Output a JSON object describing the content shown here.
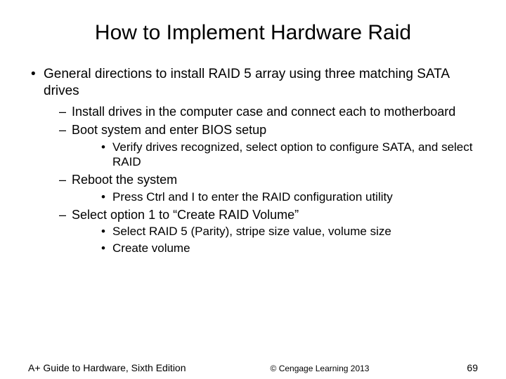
{
  "title": "How to Implement Hardware Raid",
  "bullets": {
    "l1_0": "General directions to install RAID 5 array using three matching SATA drives",
    "l2_0": "Install drives in the computer case and connect each to motherboard",
    "l2_1": "Boot system and enter BIOS setup",
    "l3_0": "Verify drives recognized, select option to configure SATA, and select RAID",
    "l2_2": "Reboot the system",
    "l3_1": "Press Ctrl and I to enter the RAID configuration utility",
    "l2_3": "Select option 1 to “Create RAID Volume”",
    "l3_2": "Select RAID 5 (Parity), stripe size value, volume size",
    "l3_3": "Create volume"
  },
  "footer": {
    "left": "A+ Guide to Hardware, Sixth Edition",
    "center": "© Cengage Learning  2013",
    "right": "69"
  }
}
